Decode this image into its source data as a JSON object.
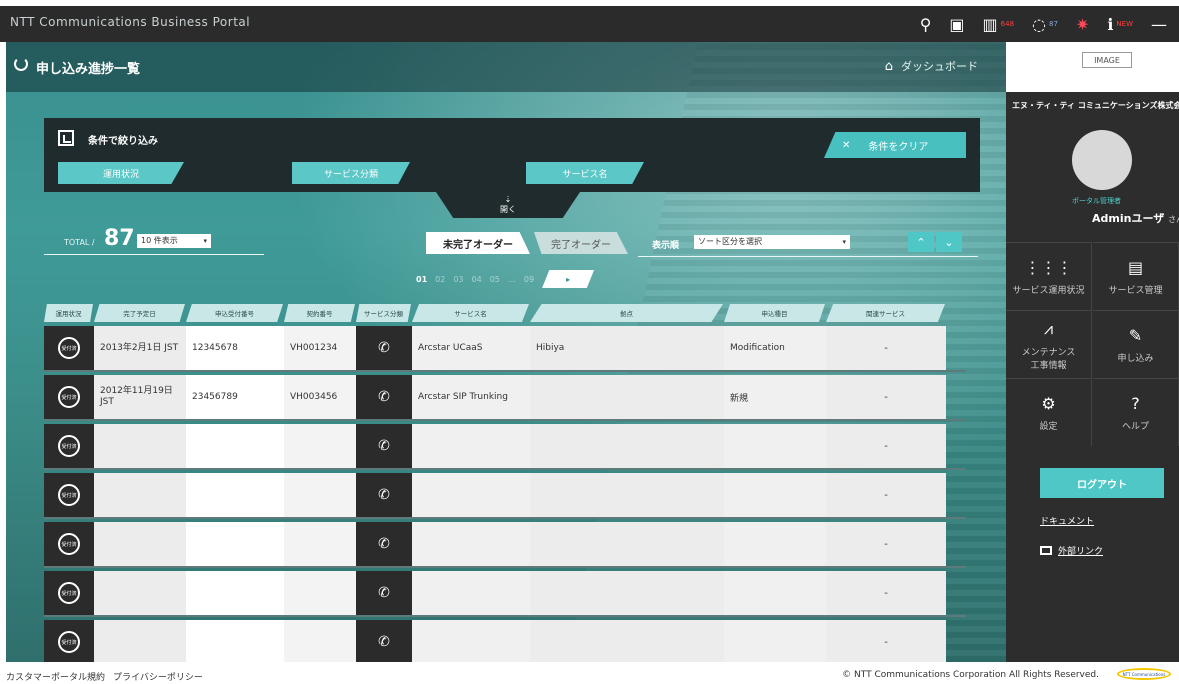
{
  "topbar": {
    "brand": "NTT Communications Business Portal",
    "icons": [
      {
        "name": "search-icon",
        "glyph": "⚲",
        "count": ""
      },
      {
        "name": "chat-icon",
        "glyph": "▣",
        "count": ""
      },
      {
        "name": "server-icon",
        "glyph": "▥",
        "count": "648"
      },
      {
        "name": "spinner-icon",
        "glyph": "◌",
        "count": "87"
      },
      {
        "name": "alert-icon",
        "glyph": "✷",
        "count": ""
      },
      {
        "name": "info-icon",
        "glyph": "ℹ",
        "count": "NEW"
      },
      {
        "name": "minimize-icon",
        "glyph": "—",
        "count": ""
      }
    ]
  },
  "page": {
    "title": "申し込み進捗一覧",
    "dashboard_link": "ダッシュボード"
  },
  "filter": {
    "title": "条件で絞り込み",
    "clear_label": "条件をクリア",
    "chips": [
      "運用状況",
      "サービス分類",
      "サービス名"
    ],
    "open_label": "開く"
  },
  "controls": {
    "total_label": "TOTAL /",
    "total_value": "87",
    "per_page": "10 件表示",
    "tab_incomplete": "未完了オーダー",
    "tab_complete": "完了オーダー",
    "sort_label": "表示順",
    "sort_select": "ソート区分を選択"
  },
  "pager": {
    "pages": [
      "01",
      "02",
      "03",
      "04",
      "05",
      "…",
      "09"
    ],
    "current": "01"
  },
  "table": {
    "headers": [
      "運用状況",
      "完了予定日",
      "申込受付番号",
      "契約番号",
      "サービス分類",
      "サービス名",
      "拠点",
      "申込種目",
      "関連サービス"
    ],
    "status_label": "受付済",
    "rows": [
      {
        "date": "2013年2月1日 JST",
        "receipt": "12345678",
        "contract": "VH001234",
        "service": "Arcstar UCaaS",
        "site": "Hibiya",
        "type": "Modification",
        "related": "-"
      },
      {
        "date": "2012年11月19日 JST",
        "receipt": "23456789",
        "contract": "VH003456",
        "service": "Arcstar SIP Trunking",
        "site": "",
        "type": "新規",
        "related": "-"
      },
      {
        "date": "",
        "receipt": "",
        "contract": "",
        "service": "",
        "site": "",
        "type": "",
        "related": "-"
      },
      {
        "date": "",
        "receipt": "",
        "contract": "",
        "service": "",
        "site": "",
        "type": "",
        "related": "-"
      },
      {
        "date": "",
        "receipt": "",
        "contract": "",
        "service": "",
        "site": "",
        "type": "",
        "related": "-"
      },
      {
        "date": "",
        "receipt": "",
        "contract": "",
        "service": "",
        "site": "",
        "type": "",
        "related": "-"
      },
      {
        "date": "",
        "receipt": "",
        "contract": "",
        "service": "",
        "site": "",
        "type": "",
        "related": "-"
      }
    ]
  },
  "sidebar": {
    "image_placeholder": "IMAGE",
    "company": "エヌ・ティ・ティ コミュニケーションズ株式会社",
    "role": "ポータル管理者",
    "user": "Adminユーザ",
    "user_suffix": "さん",
    "menu": [
      {
        "label": "サービス運用状況",
        "icon": "grid-icon",
        "glyph": "⋮⋮⋮"
      },
      {
        "label": "サービス管理",
        "icon": "document-icon",
        "glyph": "▤"
      },
      {
        "label": "メンテナンス\n工事情報",
        "icon": "maintenance-icon",
        "glyph": "⩘"
      },
      {
        "label": "申し込み",
        "icon": "apply-icon",
        "glyph": "✎"
      },
      {
        "label": "設定",
        "icon": "gear-icon",
        "glyph": "⚙"
      },
      {
        "label": "ヘルプ",
        "icon": "help-icon",
        "glyph": "?"
      }
    ],
    "logout": "ログアウト",
    "document_link": "ドキュメント",
    "external_link": "外部リンク"
  },
  "footer": {
    "terms": "カスタマーポータル規約",
    "privacy": "プライバシーポリシー",
    "copyright": "© NTT Communications Corporation All Rights Reserved.",
    "logo_text": "NTT Communications"
  },
  "colors": {
    "accent": "#4fc7c7",
    "dark": "#2b2b2b",
    "teal_bg": "#3a8f8e"
  }
}
